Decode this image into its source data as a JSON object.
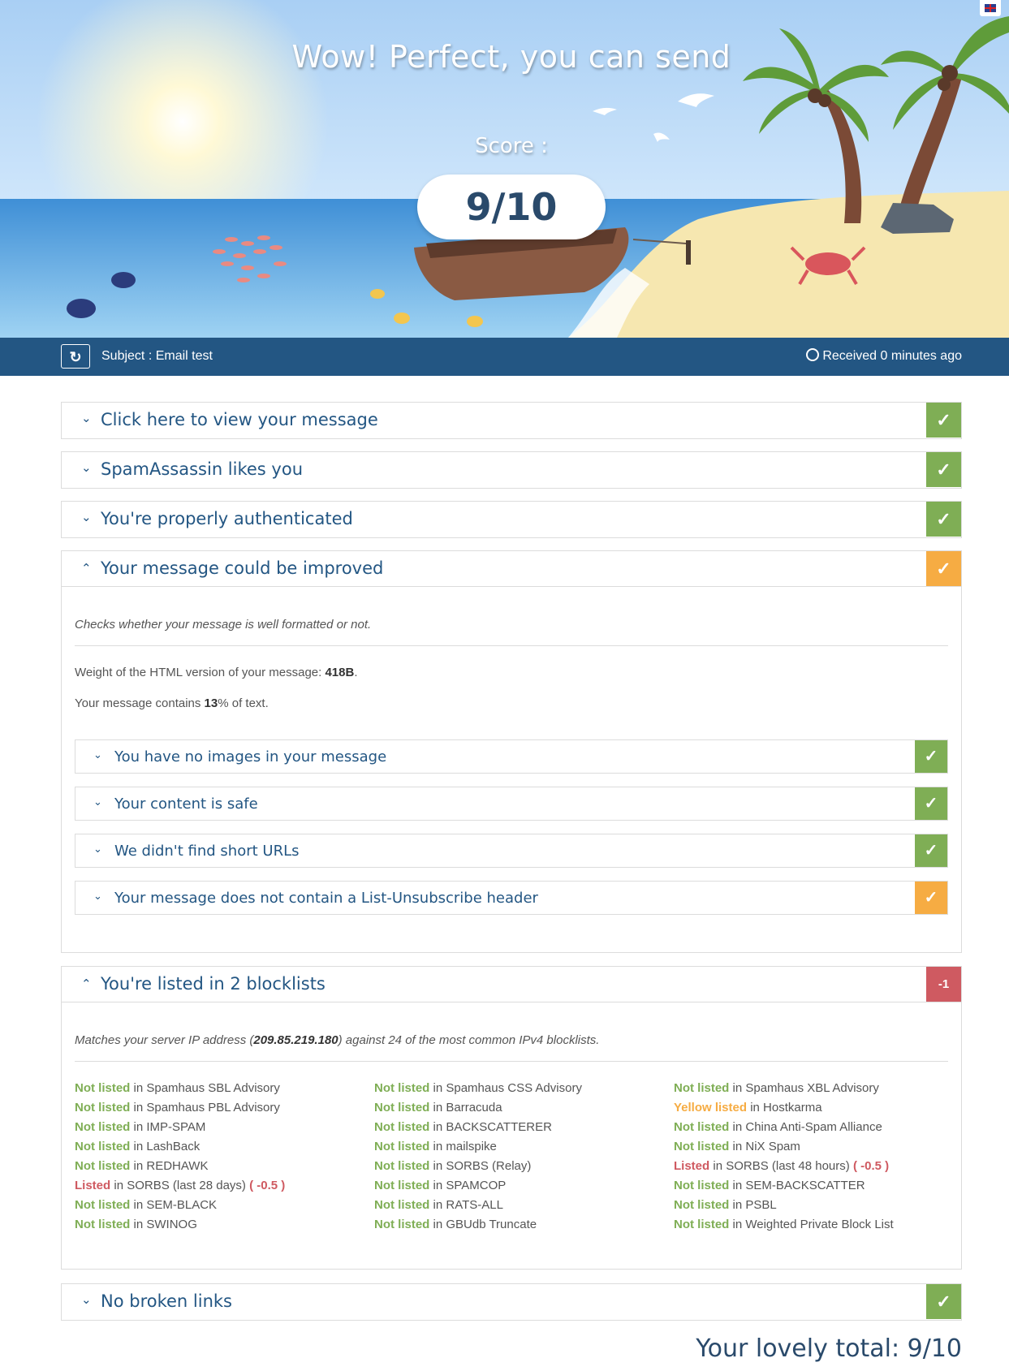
{
  "hero": {
    "title": "Wow! Perfect, you can send",
    "score_label": "Score :",
    "score": "9/10"
  },
  "infobar": {
    "refresh_icon": "refresh-icon",
    "subject": "Subject : Email test",
    "received": "Received 0 minutes ago"
  },
  "panels": [
    {
      "title": "Click here to view your message",
      "status": "✓"
    },
    {
      "title": "SpamAssassin likes you",
      "status": "✓"
    },
    {
      "title": "You're properly authenticated",
      "status": "✓"
    },
    {
      "title": "Your message could be improved",
      "status": "✓"
    }
  ],
  "format": {
    "description": "Checks whether your message is well formatted or not.",
    "weight_pre": "Weight of the HTML version of your message: ",
    "weight_value": "418B",
    "weight_post": ".",
    "text_pre": "Your message contains ",
    "text_value": "13",
    "text_post": "% of text.",
    "checks": [
      {
        "title": "You have no images in your message",
        "status": "✓"
      },
      {
        "title": "Your content is safe",
        "status": "✓"
      },
      {
        "title": "We didn't find short URLs",
        "status": "✓"
      },
      {
        "title": "Your message does not contain a List-Unsubscribe header",
        "status": "✓"
      }
    ]
  },
  "blocklists": {
    "title": "You're listed in 2 blocklists",
    "badge": "-1",
    "desc_pre": "Matches your server IP address (",
    "ip": "209.85.219.180",
    "desc_post": ") against 24 of the most common IPv4 blocklists.",
    "in": " in ",
    "columns": [
      [
        {
          "status": "Not listed",
          "name": "Spamhaus SBL Advisory"
        },
        {
          "status": "Not listed",
          "name": "Spamhaus PBL Advisory"
        },
        {
          "status": "Not listed",
          "name": "IMP-SPAM"
        },
        {
          "status": "Not listed",
          "name": "LashBack"
        },
        {
          "status": "Not listed",
          "name": "REDHAWK"
        },
        {
          "status": "Listed",
          "name": "SORBS (last 28 days)",
          "penalty": "( -0.5 )"
        },
        {
          "status": "Not listed",
          "name": "SEM-BLACK"
        },
        {
          "status": "Not listed",
          "name": "SWINOG"
        }
      ],
      [
        {
          "status": "Not listed",
          "name": "Spamhaus CSS Advisory"
        },
        {
          "status": "Not listed",
          "name": "Barracuda"
        },
        {
          "status": "Not listed",
          "name": "BACKSCATTERER"
        },
        {
          "status": "Not listed",
          "name": "mailspike"
        },
        {
          "status": "Not listed",
          "name": "SORBS (Relay)"
        },
        {
          "status": "Not listed",
          "name": "SPAMCOP"
        },
        {
          "status": "Not listed",
          "name": "RATS-ALL"
        },
        {
          "status": "Not listed",
          "name": "GBUdb Truncate"
        }
      ],
      [
        {
          "status": "Not listed",
          "name": "Spamhaus XBL Advisory"
        },
        {
          "status": "Yellow listed",
          "name": "Hostkarma"
        },
        {
          "status": "Not listed",
          "name": "China Anti-Spam Alliance"
        },
        {
          "status": "Not listed",
          "name": "NiX Spam"
        },
        {
          "status": "Listed",
          "name": "SORBS (last 48 hours)",
          "penalty": "( -0.5 )"
        },
        {
          "status": "Not listed",
          "name": "SEM-BACKSCATTER"
        },
        {
          "status": "Not listed",
          "name": "PSBL"
        },
        {
          "status": "Not listed",
          "name": "Weighted Private Block List"
        }
      ]
    ]
  },
  "links_panel": {
    "title": "No broken links",
    "status": "✓"
  },
  "total": "Your lovely total: 9/10",
  "colors": {
    "pass": "#7fae55",
    "warn": "#f6ac43",
    "fail": "#cf5a61",
    "brand": "#235683"
  }
}
